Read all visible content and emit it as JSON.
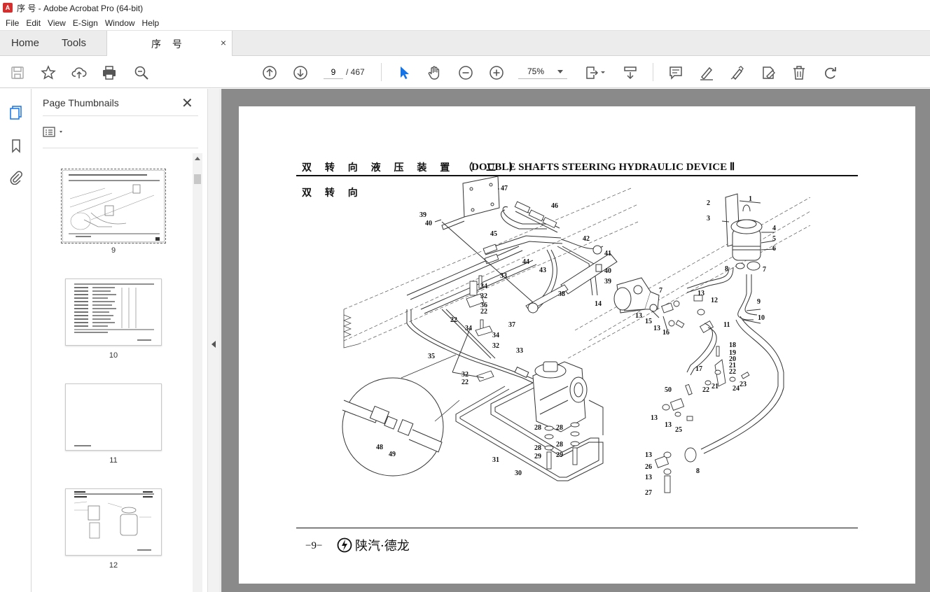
{
  "window": {
    "title": "序 号 - Adobe Acrobat Pro (64-bit)"
  },
  "menu": [
    "File",
    "Edit",
    "View",
    "E-Sign",
    "Window",
    "Help"
  ],
  "tabs": {
    "home": "Home",
    "tools": "Tools",
    "document": "序 号",
    "close": "×"
  },
  "toolbar": {
    "current_page": "9",
    "page_total": "/ 467",
    "zoom": "75%",
    "icons": [
      "save-icon",
      "bookmark-star-icon",
      "upload-icon",
      "print-icon",
      "search-zoom-icon",
      "prev-page-icon",
      "next-page-icon",
      "select-arrow-icon",
      "hand-icon",
      "zoom-out-icon",
      "zoom-in-icon",
      "page-fit-icon",
      "scroll-mode-icon",
      "comment-icon",
      "highlight-icon",
      "sign-icon",
      "stamp-icon",
      "delete-icon",
      "redo-icon"
    ]
  },
  "panel": {
    "title": "Page Thumbnails",
    "thumbnails": [
      {
        "label": "9",
        "selected": true
      },
      {
        "label": "10",
        "selected": false
      },
      {
        "label": "11",
        "selected": false
      },
      {
        "label": "12",
        "selected": false
      }
    ]
  },
  "page": {
    "header_cn": "双 转 向 液 压 装 置 （ 二 ）",
    "header_en": "DOUBLE SHAFTS STEERING HYDRAULIC DEVICE Ⅱ",
    "sub_cn": "双 转 向",
    "footer_num": "−9−",
    "footer_brand": "陕汽·德龙"
  },
  "callouts": [
    "1",
    "2",
    "3",
    "4",
    "5",
    "6",
    "7",
    "7",
    "8",
    "8",
    "9",
    "10",
    "11",
    "12",
    "13",
    "13",
    "13",
    "13",
    "13",
    "13",
    "13",
    "14",
    "15",
    "16",
    "17",
    "18",
    "19",
    "20",
    "21",
    "21",
    "22",
    "22",
    "22",
    "22",
    "23",
    "24",
    "25",
    "26",
    "27",
    "28",
    "28",
    "28",
    "28",
    "29",
    "29",
    "30",
    "31",
    "32",
    "32",
    "32",
    "33",
    "33",
    "34",
    "34",
    "34",
    "35",
    "36",
    "37",
    "38",
    "39",
    "39",
    "40",
    "40",
    "41",
    "42",
    "43",
    "44",
    "45",
    "46",
    "47",
    "48",
    "49",
    "50"
  ]
}
